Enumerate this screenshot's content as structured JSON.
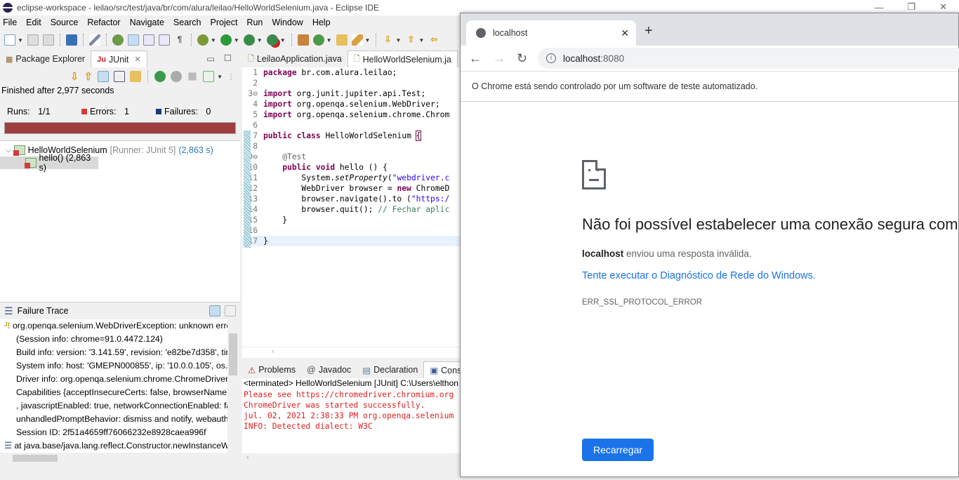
{
  "window": {
    "title": "eclipse-workspace - leilao/src/test/java/br/com/alura/leilao/HelloWorldSelenium.java - Eclipse IDE"
  },
  "menu": [
    "File",
    "Edit",
    "Source",
    "Refactor",
    "Navigate",
    "Search",
    "Project",
    "Run",
    "Window",
    "Help"
  ],
  "left_tabs": {
    "package_explorer": "Package Explorer",
    "junit": "JUnit"
  },
  "junit": {
    "status": "Finished after 2,977 seconds",
    "runs_label": "Runs:",
    "runs_value": "1/1",
    "errors_label": "Errors:",
    "errors_value": "1",
    "failures_label": "Failures:",
    "failures_value": "0",
    "progress_color": "#9e3e3f",
    "tree": [
      {
        "name": "HelloWorldSelenium",
        "runner": "[Runner: JUnit 5]",
        "time": "(2,863 s)"
      },
      {
        "name": "hello() (2,863 s)"
      }
    ]
  },
  "failure_trace": {
    "title": "Failure Trace",
    "lines": [
      "org.openqa.selenium.WebDriverException: unknown erro",
      "  (Session info: chrome=91.0.4472.124)",
      "Build info: version: '3.141.59', revision: 'e82be7d358', time",
      "System info: host: 'GMEPN000855', ip: '10.0.0.105', os.nam",
      "Driver info: org.openqa.selenium.chrome.ChromeDriver",
      "Capabilities {acceptInsecureCerts: false, browserName: ch",
      ", javascriptEnabled: true, networkConnectionEnabled: fals",
      " unhandledPromptBehavior: dismiss and notify, webauth",
      "Session ID: 2f51a4659ff76066232e8928caea996f",
      "at java.base/java.lang.reflect.Constructor.newInstanceWi"
    ]
  },
  "editor": {
    "tabs": [
      "LeilaoApplication.java",
      "HelloWorldSelenium.ja"
    ],
    "lines": [
      {
        "n": "1",
        "html": "<span class='kw'>package</span> br.com.alura.leilao;"
      },
      {
        "n": "2",
        "html": ""
      },
      {
        "n": "3⊖",
        "html": "<span class='kw'>import</span> org.junit.jupiter.api.Test;"
      },
      {
        "n": "4",
        "html": "<span class='kw'>import</span> org.openqa.selenium.WebDriver;"
      },
      {
        "n": "5",
        "html": "<span class='kw'>import</span> org.openqa.selenium.chrome.Chrom"
      },
      {
        "n": "6",
        "html": ""
      },
      {
        "n": "7",
        "html": "<span class='kw'>public</span> <span class='kw'>class</span> HelloWorldSelenium <span style='outline:1px solid #7f0055'>{</span>"
      },
      {
        "n": "8",
        "html": ""
      },
      {
        "n": "9⊖",
        "html": "    <span style='color:#646464'>@Test</span>"
      },
      {
        "n": "10",
        "html": "    <span class='kw'>public</span> <span class='kw'>void</span> hello () {"
      },
      {
        "n": "11",
        "html": "        System.<span class='it'>setProperty</span>(<span class='str'>\"webdriver.c</span>"
      },
      {
        "n": "12",
        "html": "        WebDriver browser = <span class='kw'>new</span> ChromeD"
      },
      {
        "n": "13",
        "html": "        browser.navigate().to (<span class='str'>\"https:/</span>"
      },
      {
        "n": "14",
        "html": "        browser.quit(); <span class='cm'>// Fechar aplic</span>"
      },
      {
        "n": "15",
        "html": "    }"
      },
      {
        "n": "16",
        "html": ""
      },
      {
        "n": "17",
        "html": "}"
      }
    ]
  },
  "console": {
    "tabs": [
      "Problems",
      "Javadoc",
      "Declaration",
      "Console"
    ],
    "header": "<terminated> HelloWorldSelenium [JUnit] C:\\Users\\elthon",
    "lines": [
      "Please see https://chromedriver.chromium.org",
      "ChromeDriver was started successfully.",
      "jul. 02, 2021 2:38:33 PM org.openqa.selenium",
      "INFO: Detected dialect: W3C"
    ]
  },
  "chrome": {
    "tab_title": "localhost",
    "url_host": "localhost",
    "url_port": ":8080",
    "infobar": "O Chrome está sendo controlado por um software de teste automatizado.",
    "error_title": "Não foi possível estabelecer uma conexão segura com",
    "error_host": "localhost",
    "error_desc": " enviou uma resposta inválida.",
    "error_link": "Tente executar o Diagnóstico de Rede do Windows.",
    "error_code": "ERR_SSL_PROTOCOL_ERROR",
    "reload_label": "Recarregar",
    "accent": "#1a73e8"
  }
}
